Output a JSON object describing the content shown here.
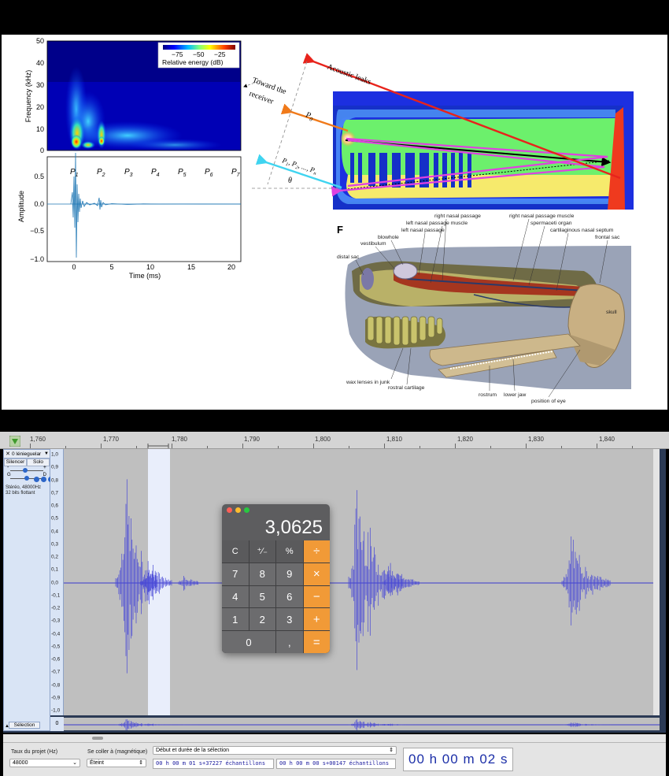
{
  "figure": {
    "colorbar": {
      "label": "Relative energy (dB)",
      "ticks": [
        "−75",
        "−50",
        "−25"
      ]
    },
    "spectrogram": {
      "ylabel": "Frequency (kHz)",
      "yticks": [
        "50",
        "40",
        "30",
        "20",
        "10",
        "0"
      ]
    },
    "waveform": {
      "ylabel": "Amplitude",
      "yticks": [
        "0.5",
        "0.0",
        "−0.5",
        "−1.0"
      ],
      "xticks": [
        "0",
        "5",
        "10",
        "15",
        "20"
      ],
      "xlabel": "Time (ms)",
      "pulses": [
        "P",
        "P",
        "P",
        "P",
        "P",
        "P",
        "P"
      ],
      "pulse_subs": [
        "1",
        "2",
        "3",
        "4",
        "5",
        "6",
        "7"
      ]
    },
    "diagram": {
      "acoustic_leaks": "Acoustic leaks",
      "toward": "Toward the",
      "receiver": "receiver",
      "p0": "P",
      "p0_sub": "0",
      "p_series": "P",
      "p_series_mid": "1",
      "p_series_rest": ", P",
      "p_series_2": "2",
      "p_series_end": ", ..., P",
      "p_series_n": "n",
      "theta": "θ"
    },
    "anatomy": {
      "panel_letter": "F",
      "labels": {
        "right_nasal_passage": "right nasal passage",
        "left_nasal_passage_muscle": "left nasal passage muscle",
        "left_nasal_passage": "left nasal passage",
        "blowhole": "blowhole",
        "vestibulum": "vestibulum",
        "distal_sac": "distal sac",
        "right_nasal_passage_muscle": "right nasal passage muscle",
        "spermaceti_organ": "spermaceti organ",
        "cartilaginous_nasal_septum": "cartilaginous nasal septum",
        "frontal_sac": "frontal sac",
        "skull": "skull",
        "wax_lenses": "wax lenses in junk",
        "rostral_cartilage": "rostral cartilage",
        "rostrum": "rostrum",
        "lower_jaw": "lower jaw",
        "position_of_eye": "position of eye"
      }
    }
  },
  "ruler": {
    "labels": [
      "1,760",
      "1,770",
      "1,780",
      "1,790",
      "1,800",
      "1,810",
      "1,820",
      "1,830",
      "1,840"
    ]
  },
  "track": {
    "close": "✕",
    "name": "0 lénieguelar",
    "mute": "Silencer",
    "solo": "Solo",
    "gain_minus": "-",
    "gain_plus": "+",
    "pan_l": "G",
    "pan_r": "D",
    "info_line1": "Stéréo, 48000Hz",
    "info_line2": "32 bits flottant",
    "select": "Sélection",
    "collapse": "▲",
    "scale": [
      "1,0",
      "0,9",
      "0,8",
      "0,7",
      "0,6",
      "0,5",
      "0,4",
      "0,3",
      "0,2",
      "0,1",
      "0,0",
      "-0,1",
      "-0,2",
      "-0,3",
      "-0,4",
      "-0,5",
      "-0,6",
      "-0,7",
      "-0,8",
      "-0,9",
      "-1,0"
    ],
    "mini_scale": "0"
  },
  "calculator": {
    "display": "3,0625",
    "keys": [
      "C",
      "⁺∕₋",
      "%",
      "÷",
      "7",
      "8",
      "9",
      "×",
      "4",
      "5",
      "6",
      "−",
      "1",
      "2",
      "3",
      "+",
      "0",
      ",",
      "="
    ],
    "colors": {
      "close": "#ff5f57",
      "min": "#febc2e",
      "max": "#28c840",
      "operator": "#f19a37"
    }
  },
  "toolbar": {
    "rate_label": "Taux du projet (Hz)",
    "rate_value": "48000",
    "snap_label": "Se coller à (magnétique)",
    "snap_value": "Éteint",
    "selection_mode": "Début et durée de la sélection",
    "start_time": "00 h 00 m 01 s+37227 échantillons",
    "duration_time": "00 h 00 m 00 s+00147 échantillons",
    "audio_position": "00 h 00 m 02 s"
  }
}
